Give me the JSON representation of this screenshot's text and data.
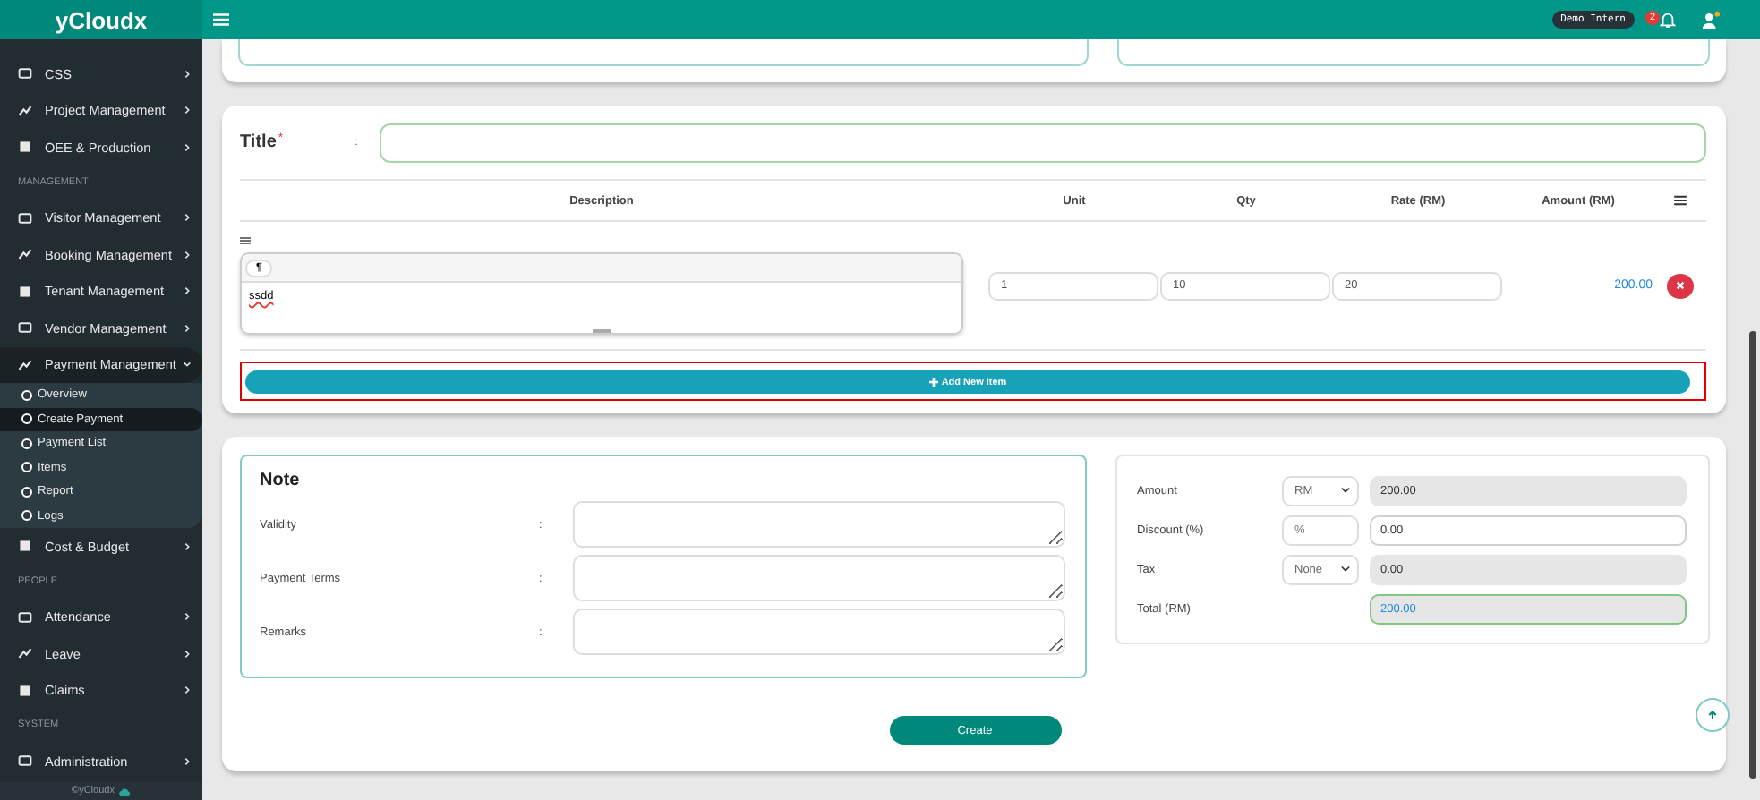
{
  "brand": "yCloudx",
  "header": {
    "user_badge": "Demo Intern",
    "notification_count": "2"
  },
  "sidebar": {
    "items": [
      {
        "kind": "menu",
        "label": "CSS",
        "selected": false,
        "expanded": false
      },
      {
        "kind": "menu",
        "label": "Project Management",
        "selected": false,
        "expanded": false
      },
      {
        "kind": "menu",
        "label": "OEE & Production",
        "selected": false,
        "expanded": false
      },
      {
        "kind": "heading",
        "label": "MANAGEMENT"
      },
      {
        "kind": "menu",
        "label": "Visitor Management",
        "selected": false,
        "expanded": false
      },
      {
        "kind": "menu",
        "label": "Booking Management",
        "selected": false,
        "expanded": false
      },
      {
        "kind": "menu",
        "label": "Tenant Management",
        "selected": false,
        "expanded": false
      },
      {
        "kind": "menu",
        "label": "Vendor Management",
        "selected": false,
        "expanded": false
      },
      {
        "kind": "menu",
        "label": "Payment Management",
        "selected": true,
        "expanded": true,
        "children": [
          {
            "label": "Overview",
            "selected": false
          },
          {
            "label": "Create Payment",
            "selected": true
          },
          {
            "label": "Payment List",
            "selected": false
          },
          {
            "label": "Items",
            "selected": false
          },
          {
            "label": "Report",
            "selected": false
          },
          {
            "label": "Logs",
            "selected": false
          }
        ]
      },
      {
        "kind": "menu",
        "label": "Cost & Budget",
        "selected": false,
        "expanded": false
      },
      {
        "kind": "heading",
        "label": "PEOPLE"
      },
      {
        "kind": "menu",
        "label": "Attendance",
        "selected": false,
        "expanded": false
      },
      {
        "kind": "menu",
        "label": "Leave",
        "selected": false,
        "expanded": false
      },
      {
        "kind": "menu",
        "label": "Claims",
        "selected": false,
        "expanded": false
      },
      {
        "kind": "heading",
        "label": "SYSTEM"
      },
      {
        "kind": "menu",
        "label": "Administration",
        "selected": false,
        "expanded": false
      }
    ],
    "footer": "©yCloudx"
  },
  "item_form": {
    "title_label": "Title",
    "required_mark": "*",
    "separator": ":",
    "columns": [
      "Description",
      "Unit",
      "Qty",
      "Rate (RM)",
      "Amount (RM)"
    ],
    "rows": [
      {
        "toolbar": "¶",
        "description": "ssdd",
        "spelling_error": true,
        "unit": "1",
        "qty": "10",
        "rate": "20",
        "amount": "200.00"
      }
    ],
    "add_button": {
      "label": "Add New Item",
      "highlighted": true
    }
  },
  "note": {
    "title": "Note",
    "fields": [
      {
        "label": "Validity",
        "separator": ":"
      },
      {
        "label": "Payment Terms",
        "separator": ":"
      },
      {
        "label": "Remarks",
        "separator": ":"
      }
    ]
  },
  "summary": {
    "rows": [
      {
        "kind": "select",
        "label": "Amount",
        "option": "RM",
        "value": "200.00",
        "readonly": true
      },
      {
        "kind": "input",
        "label": "Discount (%)",
        "placeholder": "%",
        "value": "0.00",
        "readonly": false
      },
      {
        "kind": "select",
        "label": "Tax",
        "option": "None",
        "value": "0.00",
        "readonly": true
      },
      {
        "kind": "total",
        "label": "Total (RM)",
        "value": "200.00",
        "readonly": true
      }
    ]
  },
  "create_button": "Create"
}
